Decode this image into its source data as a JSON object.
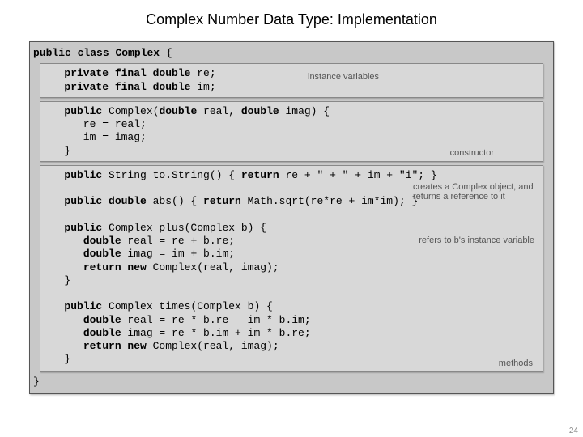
{
  "title": "Complex Number Data Type:  Implementation",
  "class_decl": {
    "line": "public class Complex {"
  },
  "ivars": {
    "l1": "   private final double re;",
    "l2": "   private final double im;",
    "label": "instance variables"
  },
  "ctor": {
    "l1": "   public Complex(double real, double imag) {",
    "l2": "      re = real;",
    "l3": "      im = imag;",
    "l4": "   }",
    "label": "constructor"
  },
  "body": {
    "tostr": "   public String to.String() { return re + \" + \" + im + \"i\"; }",
    "abs": "   public double abs() { return Math.sqrt(re*re + im*im); }",
    "plus1": "   public Complex plus(Complex b) {",
    "plus2": "      double real = re + b.re;",
    "plus3": "      double imag = im + b.im;",
    "plus4": "      return new Complex(real, imag);",
    "plus5": "   }",
    "times1": "   public Complex times(Complex b) {",
    "times2": "      double real = re * b.re – im * b.im;",
    "times3": "      double imag = re * b.im + im * b.re;",
    "times4": "      return new Complex(real, imag);",
    "times5": "   }",
    "close": "}",
    "label_create": "creates a Complex object, and returns a reference to it",
    "label_refers": "refers to b's instance variable",
    "label_methods": "methods"
  },
  "page_num": "24"
}
